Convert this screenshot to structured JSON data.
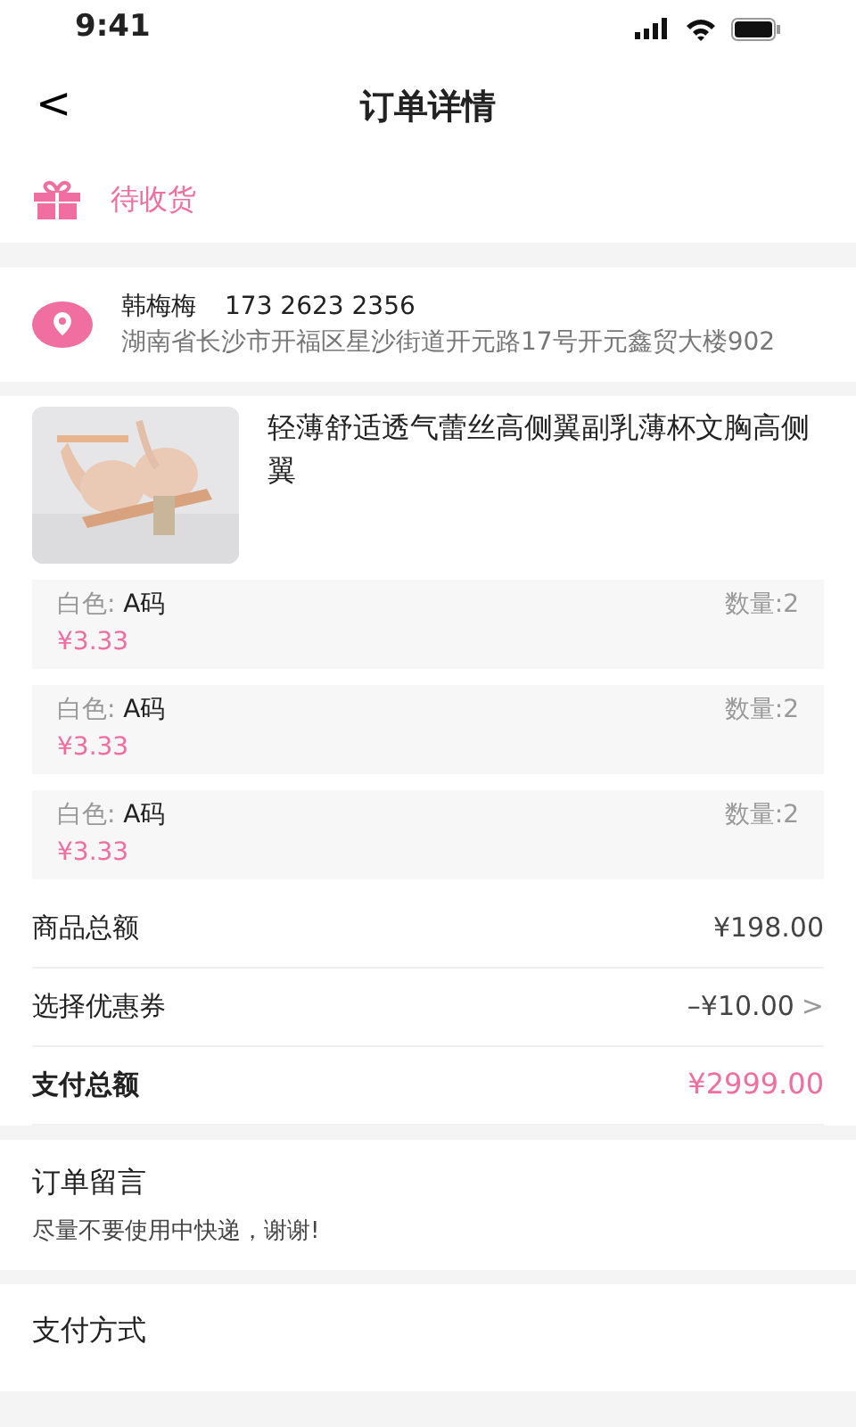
{
  "status_bar": {
    "time": "9:41"
  },
  "header": {
    "back": "<",
    "title": "订单详情"
  },
  "order_status": {
    "label": "待收货"
  },
  "address": {
    "name": "韩梅梅",
    "phone": "173 2623 2356",
    "detail": "湖南省长沙市开福区星沙街道开元路17号开元鑫贸大楼902"
  },
  "product": {
    "title": "轻薄舒适透气蕾丝高侧翼副乳薄杯文胸高侧翼",
    "variants": [
      {
        "color_label": "白色:",
        "size": "A码",
        "price": "¥3.33",
        "quantity": "数量:2"
      },
      {
        "color_label": "白色:",
        "size": "A码",
        "price": "¥3.33",
        "quantity": "数量:2"
      },
      {
        "color_label": "白色:",
        "size": "A码",
        "price": "¥3.33",
        "quantity": "数量:2"
      }
    ]
  },
  "summary": [
    {
      "kind": "plain",
      "label": "商品总额",
      "value": "¥198.00"
    },
    {
      "kind": "link",
      "label": "选择优惠券",
      "value": "–¥10.00",
      "chevron": ">"
    },
    {
      "kind": "total",
      "label": "支付总额",
      "value": "¥2999.00"
    }
  ],
  "note": {
    "title": "订单留言",
    "text": "尽量不要使用中快递，谢谢!"
  },
  "payment": {
    "title": "支付方式"
  }
}
